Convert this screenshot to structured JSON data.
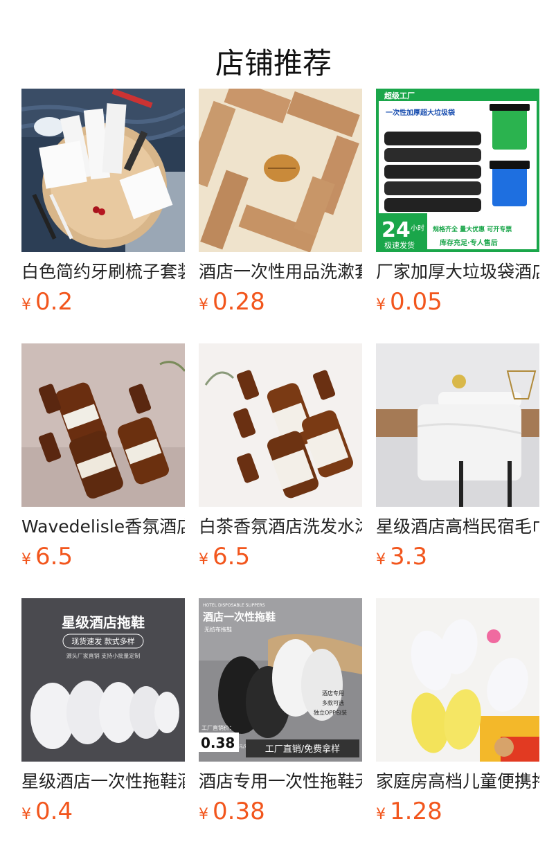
{
  "header": {
    "title": "店铺推荐"
  },
  "products": [
    {
      "name": "白色简约牙刷梳子套装",
      "currency": "¥",
      "price": "0.2",
      "image": "toothbrush-comb-set-image"
    },
    {
      "name": "酒店一次性用品洗漱套装",
      "currency": "¥",
      "price": "0.28",
      "image": "kraft-box-amenities-image"
    },
    {
      "name": "厂家加厚大垃圾袋酒店",
      "currency": "¥",
      "price": "0.05",
      "image": "garbage-bag-image"
    },
    {
      "name": "Wavedelisle香氛酒店",
      "currency": "¥",
      "price": "6.5",
      "image": "amber-bottles-image"
    },
    {
      "name": "白茶香氛酒店洗发水沐",
      "currency": "¥",
      "price": "6.5",
      "image": "white-tea-bottles-image"
    },
    {
      "name": "星级酒店高档民宿毛巾",
      "currency": "¥",
      "price": "3.3",
      "image": "white-towels-image"
    },
    {
      "name": "星级酒店一次性拖鞋酒",
      "currency": "¥",
      "price": "0.4",
      "image": "white-slippers-image"
    },
    {
      "name": "酒店专用一次性拖鞋无",
      "currency": "¥",
      "price": "0.38",
      "image": "disposable-slippers-image"
    },
    {
      "name": "家庭房高档儿童便携拖",
      "currency": "¥",
      "price": "1.28",
      "image": "kids-slippers-image"
    }
  ],
  "image_text": {
    "garbage_brand": "超级工厂",
    "garbage_headline": "一次性加厚超大垃圾袋",
    "garbage_hours": "24",
    "garbage_hours_unit": "小时",
    "garbage_ship": "极速发货",
    "garbage_note1": "规格齐全 量大优惠 可开专票",
    "garbage_note2": "库存充足·专人售后",
    "slipper_title": "星级酒店拖鞋",
    "slipper_sub": "现货速发  款式多样",
    "slipper_sub2": "源头厂家直销 支持小批量定制",
    "disp_title": "酒店一次性拖鞋",
    "disp_small": "HOTEL DISPOSABLE SLIPPERS",
    "disp_tag": "无纺布拖鞋",
    "disp_check1": "酒店专用",
    "disp_check2": "多款可选",
    "disp_check3": "独立OPP包装",
    "disp_price_label": "工厂直销价：",
    "disp_price": "0.38",
    "disp_price_unit": "元/双",
    "disp_banner": "工厂直销/免费拿样"
  },
  "colors": {
    "price": "#f2561d",
    "text": "#222222",
    "garbage_green": "#1aa64a"
  }
}
